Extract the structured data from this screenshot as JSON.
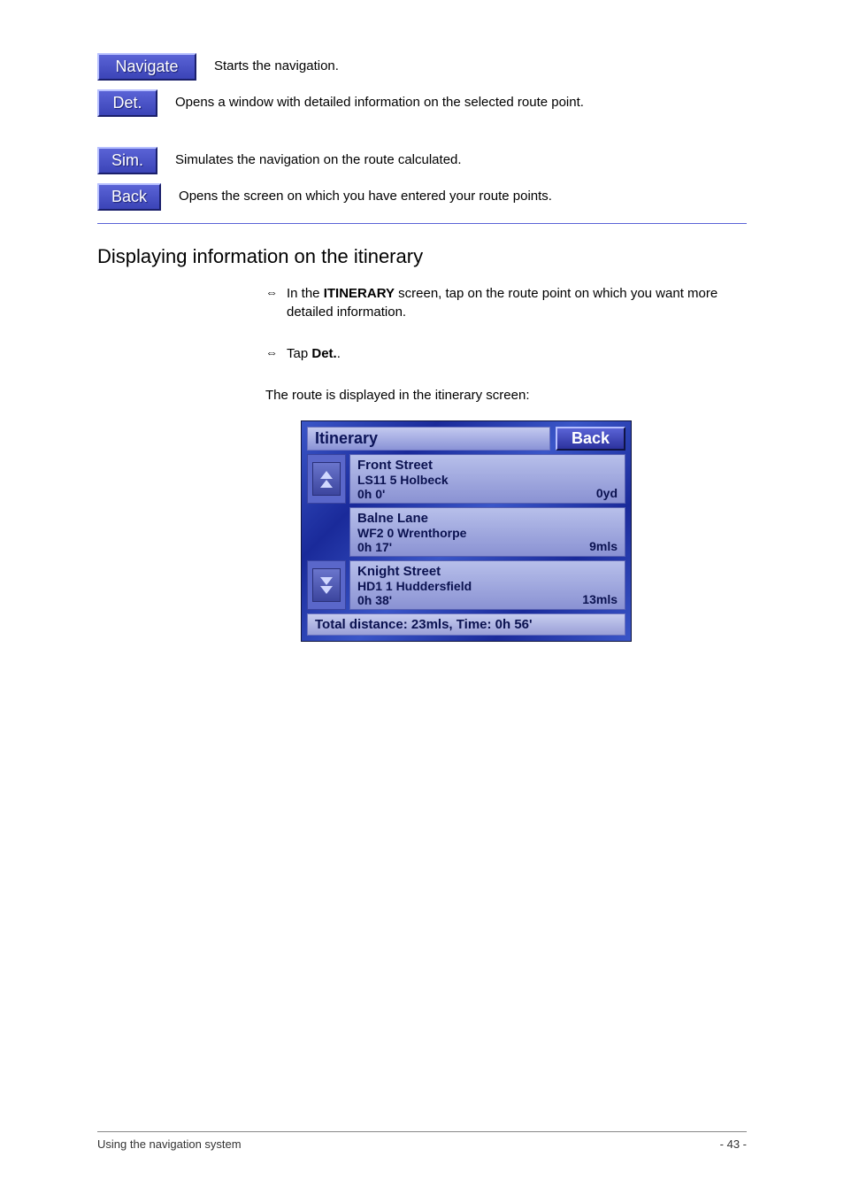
{
  "buttons": {
    "navigate": {
      "label": "Navigate",
      "desc": "Starts the navigation."
    },
    "det": {
      "label": "Det.",
      "desc": "Opens a window with detailed information on the selected route point."
    },
    "sim": {
      "label": "Sim.",
      "desc": "Simulates the navigation on the route calculated."
    },
    "back": {
      "label": "Back",
      "desc": "Opens the screen on which you have entered your route points."
    }
  },
  "section_title": "Displaying information on the itinerary",
  "bullets": [
    {
      "prefix": "In the ",
      "bold": "ITINERARY",
      "suffix": " screen, tap on the route point on which you want more detailed information."
    },
    {
      "prefix": "Tap ",
      "bold": "Det.",
      "suffix": "."
    }
  ],
  "chapter_intro": "The route is displayed in the itinerary screen:",
  "panel": {
    "title": "Itinerary",
    "back": "Back",
    "rows": [
      {
        "line1": "Front Street",
        "line2": "LS11 5 Holbeck",
        "line3": "0h 0'",
        "dist": "0yd",
        "icon": "up"
      },
      {
        "line1": "Balne Lane",
        "line2": "WF2 0 Wrenthorpe",
        "line3": "0h 17'",
        "dist": "9mls",
        "icon": "none"
      },
      {
        "line1": "Knight Street",
        "line2": "HD1 1 Huddersfield",
        "line3": "0h 38'",
        "dist": "13mls",
        "icon": "down"
      }
    ],
    "footer": "Total distance: 23mls, Time: 0h 56'"
  },
  "footer": {
    "left": "Using the navigation system",
    "right": "- 43 -"
  }
}
